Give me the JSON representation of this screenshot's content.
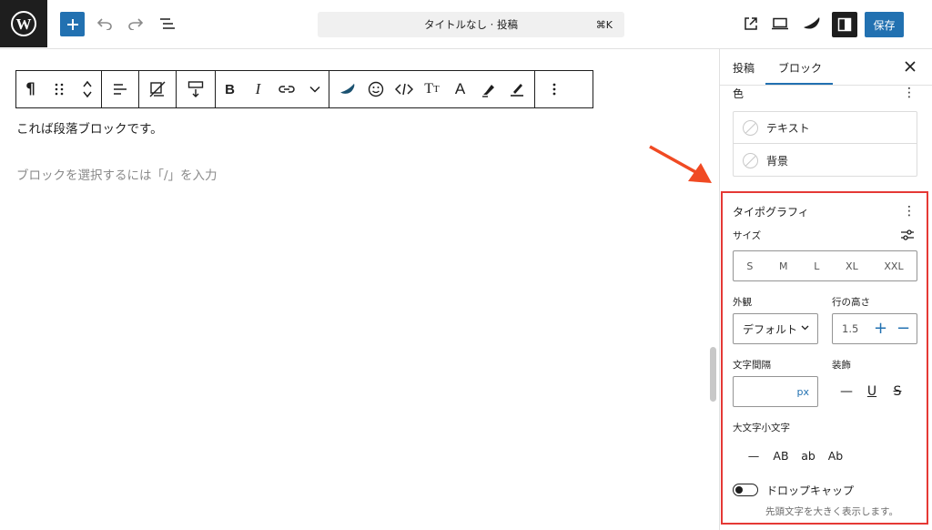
{
  "header": {
    "title": "タイトルなし · 投稿",
    "shortcut": "⌘K",
    "save_label": "保存"
  },
  "editor": {
    "paragraph_text": "これば段落ブロックです。",
    "placeholder": "ブロックを選択するには「/」を入力"
  },
  "sidebar": {
    "tabs": [
      "投稿",
      "ブロック"
    ],
    "active_tab": "ブロック",
    "color": {
      "label": "色",
      "items": [
        "テキスト",
        "背景"
      ]
    },
    "typography": {
      "title": "タイポグラフィ",
      "size_label": "サイズ",
      "sizes": [
        "S",
        "M",
        "L",
        "XL",
        "XXL"
      ],
      "appearance_label": "外観",
      "appearance_value": "デフォルト",
      "line_height_label": "行の高さ",
      "line_height_value": "1.5",
      "letter_spacing_label": "文字間隔",
      "letter_spacing_unit": "px",
      "decoration_label": "装飾",
      "decorations": [
        "—",
        "U",
        "S"
      ],
      "case_label": "大文字小文字",
      "cases": [
        "—",
        "AB",
        "ab",
        "Ab"
      ],
      "drop_cap_label": "ドロップキャップ",
      "drop_cap_help": "先頭文字を大きく表示します。",
      "drop_cap_enabled": false
    }
  },
  "colors": {
    "accent": "#2271b1",
    "highlight_frame": "#e53935",
    "arrow": "#f04a23"
  }
}
